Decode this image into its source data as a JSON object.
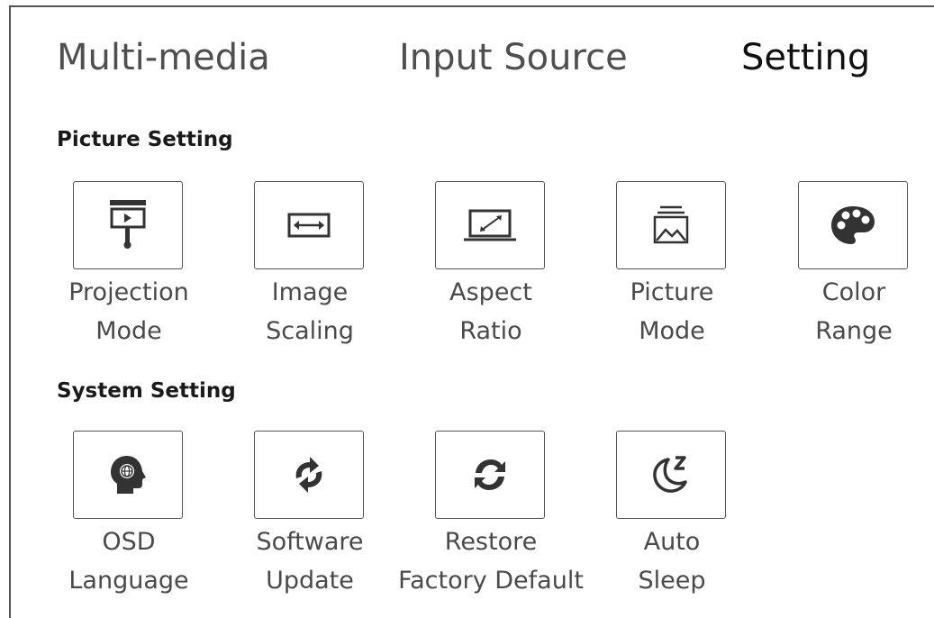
{
  "tabs": [
    {
      "label": "Multi-media",
      "active": false
    },
    {
      "label": "Input Source",
      "active": false
    },
    {
      "label": "Setting",
      "active": true
    }
  ],
  "picture_setting": {
    "title": "Picture Setting",
    "items": [
      {
        "line1": "Projection",
        "line2": "Mode",
        "icon": "projection-screen-icon"
      },
      {
        "line1": "Image",
        "line2": "Scaling",
        "icon": "horizontal-scale-icon"
      },
      {
        "line1": "Aspect",
        "line2": "Ratio",
        "icon": "aspect-ratio-icon"
      },
      {
        "line1": "Picture",
        "line2": "Mode",
        "icon": "picture-stack-icon"
      },
      {
        "line1": "Color",
        "line2": "Range",
        "icon": "palette-icon"
      }
    ]
  },
  "system_setting": {
    "title": "System Setting",
    "items": [
      {
        "line1": "OSD",
        "line2": "Language",
        "icon": "head-globe-icon"
      },
      {
        "line1": "Software",
        "line2": "Update",
        "icon": "sync-arrows-icon"
      },
      {
        "line1": "Restore",
        "line2": "Factory Default",
        "icon": "refresh-icon"
      },
      {
        "line1": "Auto",
        "line2": "Sleep",
        "icon": "moon-sleep-icon"
      }
    ]
  },
  "colors": {
    "icon": "#333333",
    "border": "#555555",
    "text": "#4a4a4a",
    "active_tab": "#111111"
  }
}
